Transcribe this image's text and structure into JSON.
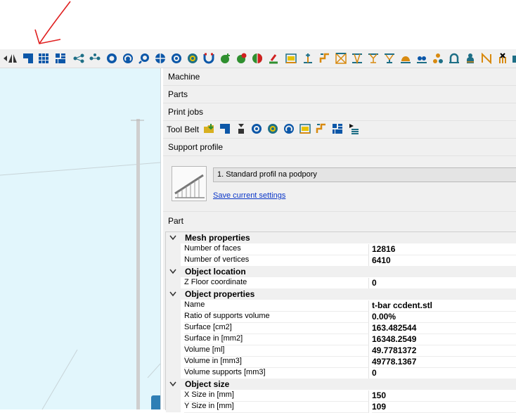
{
  "toolbar": {
    "colors": {
      "blue": "#0c57a8",
      "teal": "#1e6f86",
      "green": "#2f8f2f",
      "orange": "#d88a10",
      "red": "#d02020",
      "yellow": "#e6c200"
    }
  },
  "panel": {
    "sections": {
      "machine": "Machine",
      "parts": "Parts",
      "print_jobs": "Print jobs",
      "tool_belt": "Tool Belt",
      "support_profile": "Support profile",
      "part": "Part"
    },
    "support_profile": {
      "selected": "1. Standard profil na podpory",
      "save_link": "Save current settings"
    },
    "properties": [
      {
        "category": "Mesh properties",
        "rows": [
          {
            "key": "Number of faces",
            "value": "12816"
          },
          {
            "key": "Number of vertices",
            "value": "6410"
          }
        ]
      },
      {
        "category": "Object location",
        "rows": [
          {
            "key": "Z Floor coordinate",
            "value": "0"
          }
        ]
      },
      {
        "category": "Object properties",
        "rows": [
          {
            "key": "Name",
            "value": "t-bar ccdent.stl"
          },
          {
            "key": "Ratio of supports volume",
            "value": "0.00%"
          },
          {
            "key": "Surface [cm2]",
            "value": "163.482544"
          },
          {
            "key": "Surface in [mm2]",
            "value": "16348.2549"
          },
          {
            "key": "Volume [ml]",
            "value": "49.7781372"
          },
          {
            "key": "Volume in [mm3]",
            "value": "49778.1367"
          },
          {
            "key": "Volume supports [mm3]",
            "value": "0"
          }
        ]
      },
      {
        "category": "Object size",
        "rows": [
          {
            "key": "X Size in [mm]",
            "value": "150"
          },
          {
            "key": "Y Size in [mm]",
            "value": "109"
          }
        ]
      }
    ]
  }
}
